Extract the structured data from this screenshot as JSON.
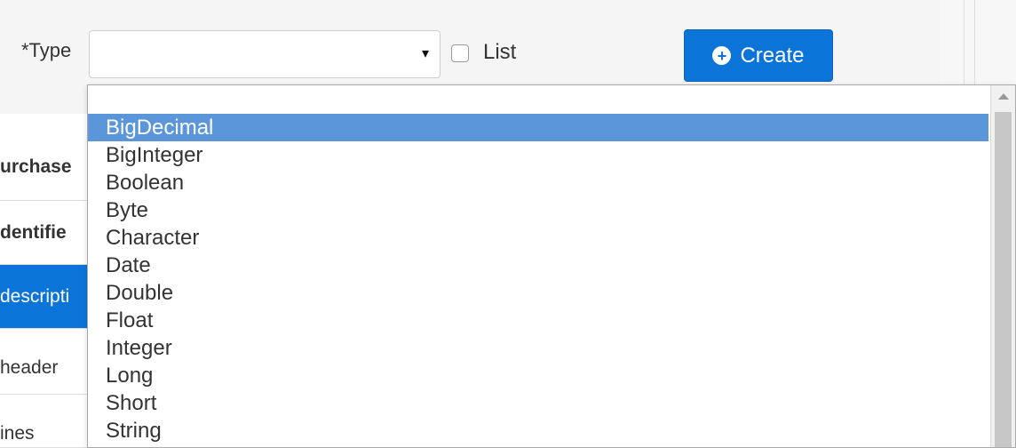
{
  "form": {
    "type_label": "*Type",
    "select_value": "",
    "select_arrow": "▾",
    "list_label": "List",
    "list_checked": false,
    "create_button": {
      "icon": "plus-circle-icon",
      "icon_glyph": "+",
      "label": "Create"
    }
  },
  "left_nav": {
    "items": [
      {
        "label": "urchase"
      },
      {
        "label": "dentifie"
      },
      {
        "label": "descripti"
      },
      {
        "label": "header"
      },
      {
        "label": "ines"
      }
    ]
  },
  "dropdown": {
    "options": [
      {
        "label": "BigDecimal",
        "selected": true
      },
      {
        "label": "BigInteger",
        "selected": false
      },
      {
        "label": "Boolean",
        "selected": false
      },
      {
        "label": "Byte",
        "selected": false
      },
      {
        "label": "Character",
        "selected": false
      },
      {
        "label": "Date",
        "selected": false
      },
      {
        "label": "Double",
        "selected": false
      },
      {
        "label": "Float",
        "selected": false
      },
      {
        "label": "Integer",
        "selected": false
      },
      {
        "label": "Long",
        "selected": false
      },
      {
        "label": "Short",
        "selected": false
      },
      {
        "label": "String",
        "selected": false
      }
    ]
  },
  "colors": {
    "primary": "#0b74d9",
    "selected_option": "#5b96db",
    "panel_background": "#f5f5f5"
  }
}
